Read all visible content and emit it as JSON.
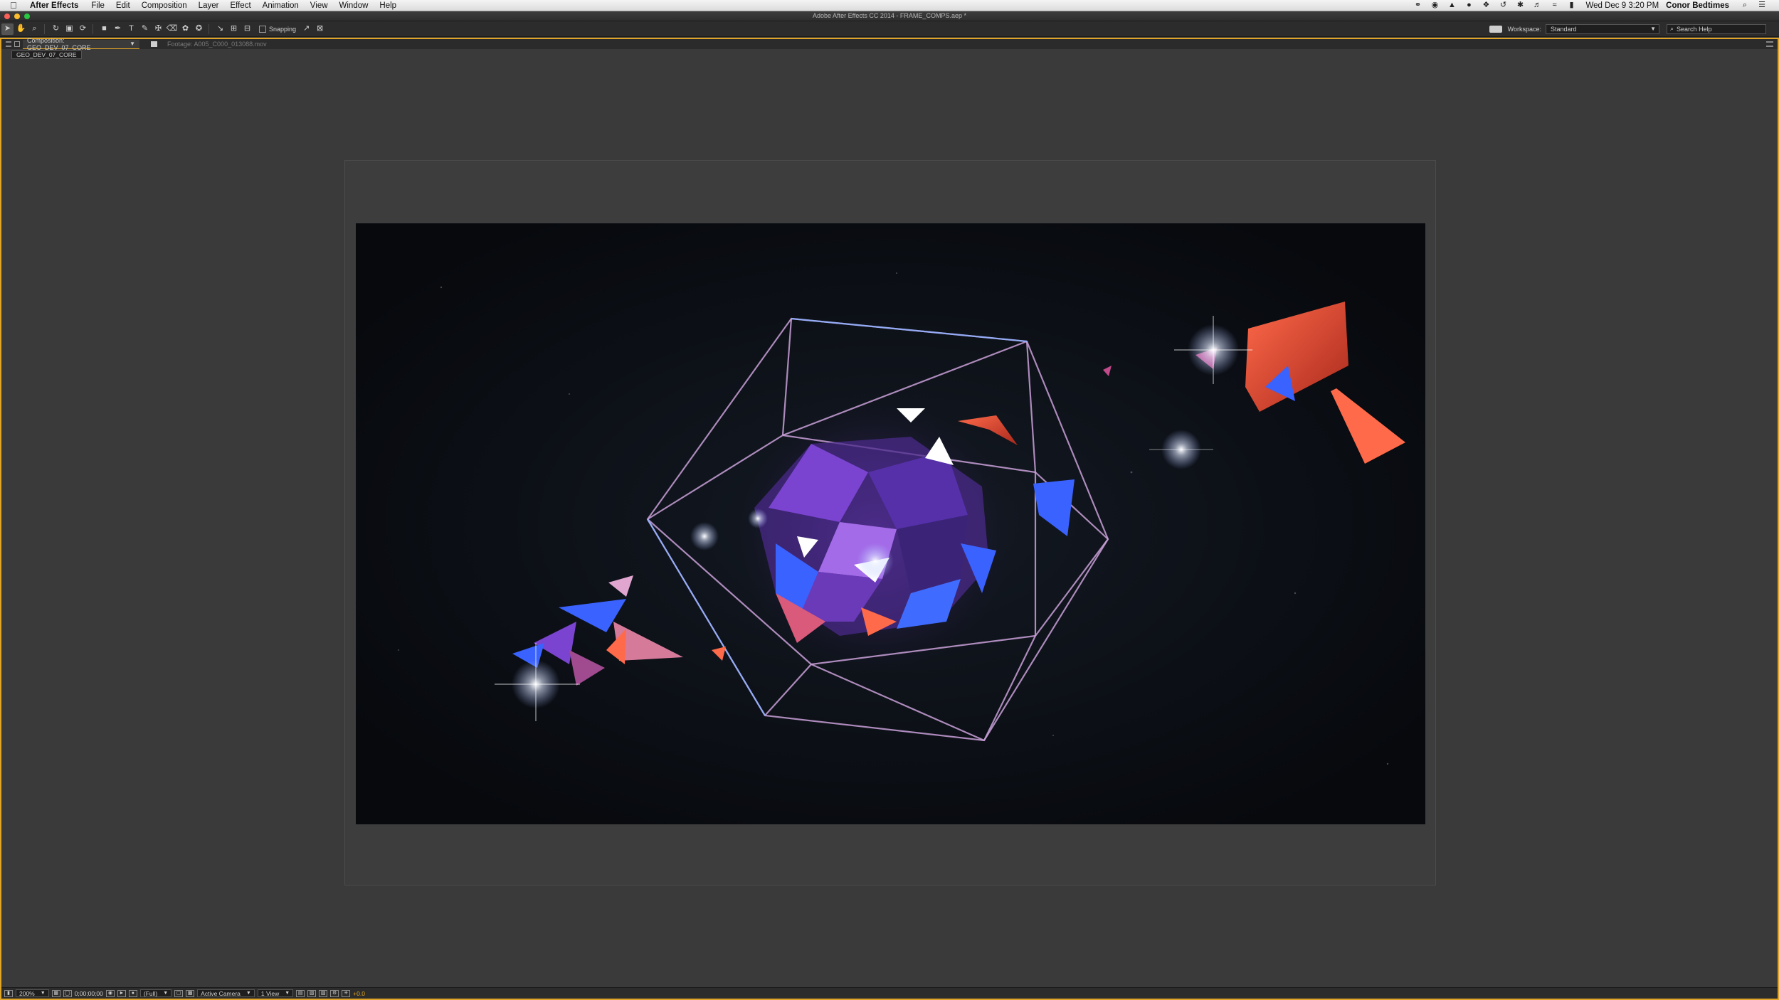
{
  "menubar": {
    "app_name": "After Effects",
    "items": [
      "File",
      "Edit",
      "Composition",
      "Layer",
      "Effect",
      "Animation",
      "View",
      "Window",
      "Help"
    ],
    "clock": "Wed Dec 9  3:20 PM",
    "user": "Conor Bedtimes"
  },
  "window": {
    "title": "Adobe After Effects CC 2014 - FRAME_COMPS.aep *"
  },
  "toolbar": {
    "snapping_label": "Snapping",
    "workspace_label": "Workspace:",
    "workspace_value": "Standard",
    "search_placeholder": "Search Help"
  },
  "composition_panel": {
    "active_tab": "Composition: GEO_DEV_07_CORE",
    "footage_tab": "Footage: A005_C000_013088.mov",
    "breadcrumb": "GEO_DEV_07_CORE"
  },
  "viewer": {
    "zoom": "200%",
    "timecode": "0;00;00;00",
    "resolution": "(Full)",
    "camera": "Active Camera",
    "views": "1 View",
    "exposure": "+0.0"
  },
  "colors": {
    "accent": "#e0a526",
    "panel_bg": "#3a3a3a",
    "comp_bg": "#0a0d12"
  }
}
